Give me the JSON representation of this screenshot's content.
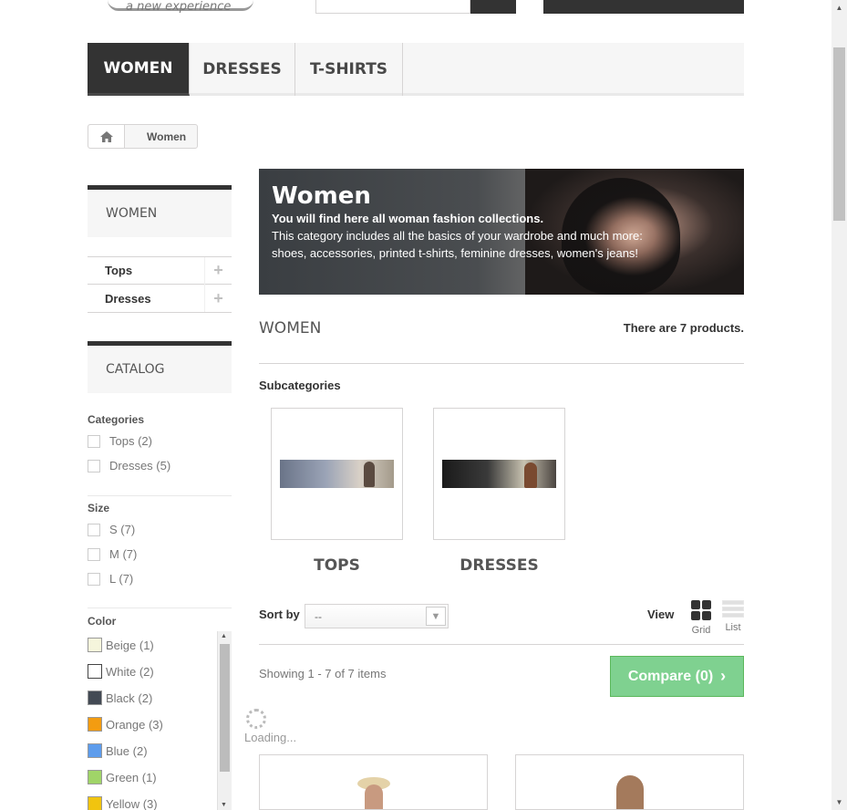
{
  "header": {
    "tagline": "a new experience"
  },
  "menu": {
    "items": [
      {
        "label": "WOMEN"
      },
      {
        "label": "DRESSES"
      },
      {
        "label": "T-SHIRTS"
      }
    ]
  },
  "breadcrumb": {
    "current": "Women"
  },
  "sidebar": {
    "women_title": "WOMEN",
    "categories": [
      {
        "label": "Tops"
      },
      {
        "label": "Dresses"
      }
    ],
    "catalog_title": "CATALOG",
    "filters": {
      "categories_label": "Categories",
      "categories": [
        {
          "label": "Tops (2)"
        },
        {
          "label": "Dresses (5)"
        }
      ],
      "size_label": "Size",
      "sizes": [
        {
          "label": "S (7)"
        },
        {
          "label": "M (7)"
        },
        {
          "label": "L (7)"
        }
      ],
      "color_label": "Color",
      "colors": [
        {
          "label": "Beige (1)",
          "hex": "#f5f5dc"
        },
        {
          "label": "White (2)",
          "hex": "#ffffff"
        },
        {
          "label": "Black (2)",
          "hex": "#434a54"
        },
        {
          "label": "Orange (3)",
          "hex": "#f39c11"
        },
        {
          "label": "Blue (2)",
          "hex": "#5d9cec"
        },
        {
          "label": "Green (1)",
          "hex": "#a0d468"
        },
        {
          "label": "Yellow (3)",
          "hex": "#f1c40f"
        }
      ]
    }
  },
  "banner": {
    "title": "Women",
    "subtitle": "You will find here all woman fashion collections.",
    "line1": "This category includes all the basics of your wardrobe and much more:",
    "line2": "shoes, accessories, printed t-shirts, feminine dresses, women's jeans!"
  },
  "category": {
    "heading": "WOMEN",
    "product_count": "There are 7 products.",
    "subcategories_label": "Subcategories",
    "subcategories": [
      {
        "name": "TOPS"
      },
      {
        "name": "DRESSES"
      }
    ]
  },
  "toolbar": {
    "sort_label": "Sort by",
    "sort_value": "--",
    "view_label": "View",
    "grid_label": "Grid",
    "list_label": "List",
    "showing": "Showing 1 - 7 of 7 items",
    "compare_label": "Compare (0)"
  },
  "loading": {
    "text": "Loading..."
  },
  "colors": {
    "menu_active": "#333333",
    "compare": "#7fd190"
  }
}
